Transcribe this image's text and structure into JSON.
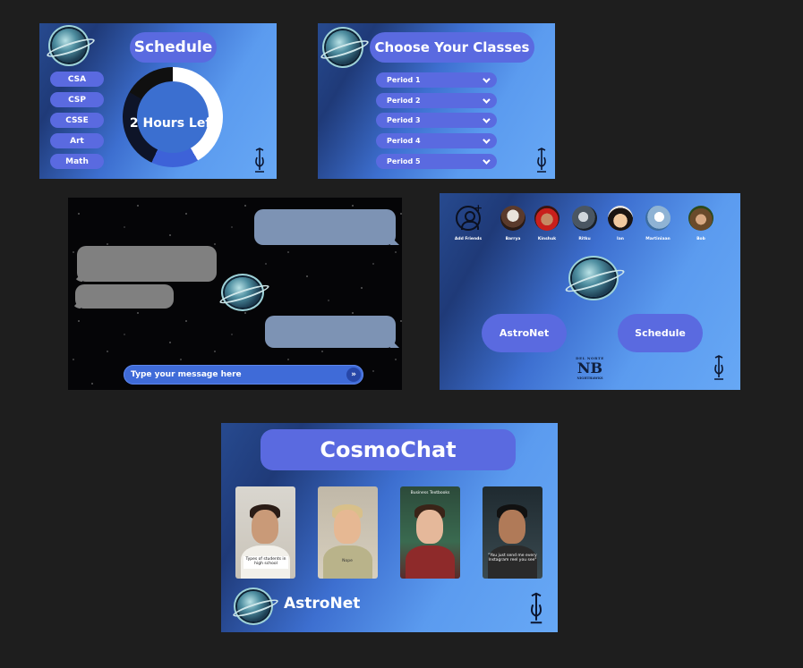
{
  "schedule_screen": {
    "title": "Schedule",
    "classes": [
      "CSA",
      "CSP",
      "CSSE",
      "Art",
      "Math"
    ],
    "timer_label": "2 Hours Left"
  },
  "classes_screen": {
    "title": "Choose Your Classes",
    "periods": [
      "Period 1",
      "Period 2",
      "Period 3",
      "Period 4",
      "Period 5"
    ]
  },
  "chat_screen": {
    "input_placeholder": "Type your message here",
    "send_icon": "double-chevron-right"
  },
  "home_screen": {
    "add_friends_label": "Add Friends",
    "friends": [
      "Barrya",
      "Kinshuk",
      "Ritku",
      "Ian",
      "Martiniaan",
      "Bob"
    ],
    "buttons": [
      "AstroNet",
      "Schedule"
    ],
    "school_logo": {
      "top": "DEL NORTE",
      "monogram": "NB",
      "bottom": "NIGHTHAWKS"
    }
  },
  "cosmochat_screen": {
    "title": "CosmoChat",
    "videos": [
      {
        "caption": "Types of students in high school"
      },
      {
        "caption": "Nope"
      },
      {
        "caption": "Business Textbooks"
      },
      {
        "caption": "\"You just send me every Instagram reel you see\""
      }
    ],
    "brand": "AstroNet"
  },
  "colors": {
    "background": "#1e1e1e",
    "pill": "#5a6ae0",
    "gradient_dark": "#1f3a78",
    "gradient_light": "#67a8f5"
  }
}
